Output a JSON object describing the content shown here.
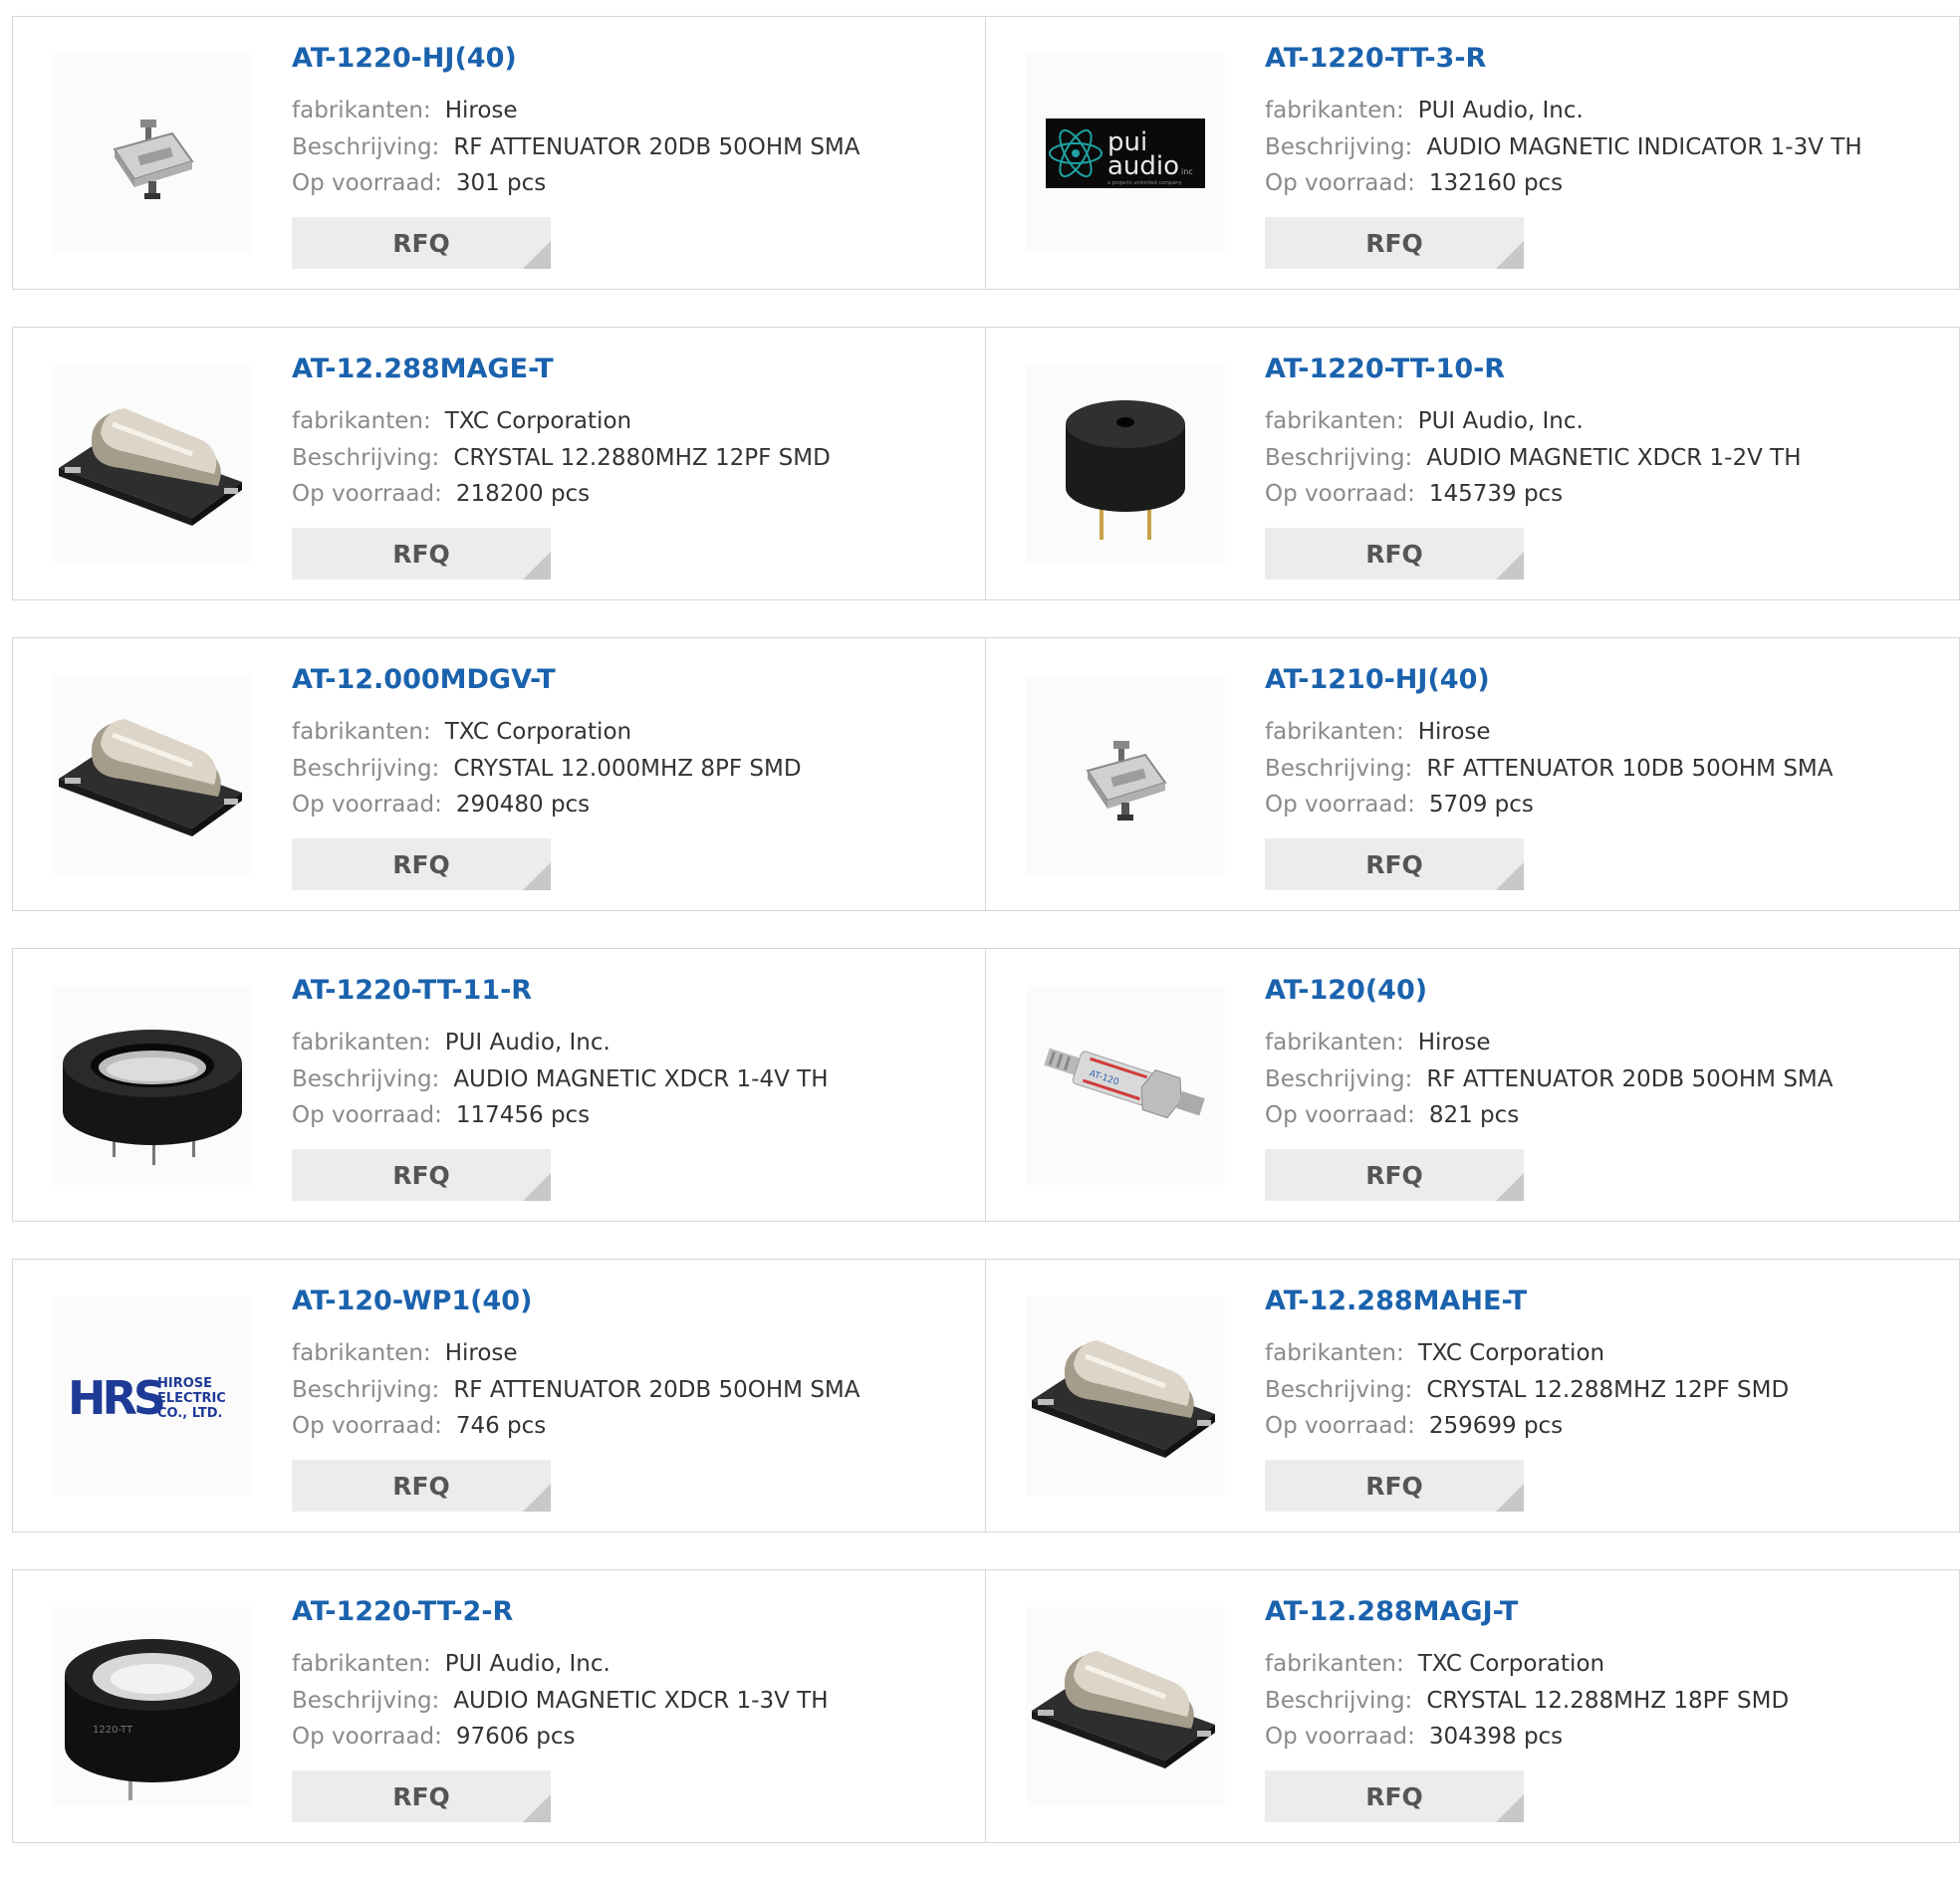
{
  "labels": {
    "manufacturer": "fabrikanten:",
    "description": "Beschrijving:",
    "stock": "Op voorraad:",
    "rfq": "RFQ"
  },
  "colors": {
    "title": "#1a62ad",
    "label": "#8a8a8a",
    "value": "#333333",
    "button_bg": "#ececec",
    "border": "#d7d7d7"
  },
  "logos": {
    "pui": {
      "line1": "pui",
      "line2": "audio",
      "suffix": "inc",
      "tagline": "a projects unlimited company"
    },
    "hrs": {
      "mark": "HRS",
      "line1": "HIROSE",
      "line2": "ELECTRIC",
      "line3": "CO., LTD."
    }
  },
  "products": [
    {
      "part": "AT-1220-HJ(40)",
      "manufacturer": "Hirose",
      "description": "RF ATTENUATOR 20DB 50OHM SMA",
      "stock": "301 pcs",
      "image": "attenuator-small-icon"
    },
    {
      "part": "AT-1220-TT-3-R",
      "manufacturer": "PUI Audio, Inc.",
      "description": "AUDIO MAGNETIC INDICATOR 1-3V TH",
      "stock": "132160 pcs",
      "image": "pui-audio-logo"
    },
    {
      "part": "AT-12.288MAGE-T",
      "manufacturer": "TXC Corporation",
      "description": "CRYSTAL 12.2880MHZ 12PF SMD",
      "stock": "218200 pcs",
      "image": "crystal-smd-icon"
    },
    {
      "part": "AT-1220-TT-10-R",
      "manufacturer": "PUI Audio, Inc.",
      "description": "AUDIO MAGNETIC XDCR 1-2V TH",
      "stock": "145739 pcs",
      "image": "buzzer-icon"
    },
    {
      "part": "AT-12.000MDGV-T",
      "manufacturer": "TXC Corporation",
      "description": "CRYSTAL 12.000MHZ 8PF SMD",
      "stock": "290480 pcs",
      "image": "crystal-smd-icon"
    },
    {
      "part": "AT-1210-HJ(40)",
      "manufacturer": "Hirose",
      "description": "RF ATTENUATOR 10DB 50OHM SMA",
      "stock": "5709 pcs",
      "image": "attenuator-small-icon"
    },
    {
      "part": "AT-1220-TT-11-R",
      "manufacturer": "PUI Audio, Inc.",
      "description": "AUDIO MAGNETIC XDCR 1-4V TH",
      "stock": "117456 pcs",
      "image": "transducer-ring-icon"
    },
    {
      "part": "AT-120(40)",
      "manufacturer": "Hirose",
      "description": "RF ATTENUATOR 20DB 50OHM SMA",
      "stock": "821 pcs",
      "image": "sma-attenuator-icon"
    },
    {
      "part": "AT-120-WP1(40)",
      "manufacturer": "Hirose",
      "description": "RF ATTENUATOR 20DB 50OHM SMA",
      "stock": "746 pcs",
      "image": "hirose-logo"
    },
    {
      "part": "AT-12.288MAHE-T",
      "manufacturer": "TXC Corporation",
      "description": "CRYSTAL 12.288MHZ 12PF SMD",
      "stock": "259699 pcs",
      "image": "crystal-smd-icon"
    },
    {
      "part": "AT-1220-TT-2-R",
      "manufacturer": "PUI Audio, Inc.",
      "description": "AUDIO MAGNETIC XDCR 1-3V TH",
      "stock": "97606 pcs",
      "image": "transducer-white-icon"
    },
    {
      "part": "AT-12.288MAGJ-T",
      "manufacturer": "TXC Corporation",
      "description": "CRYSTAL 12.288MHZ 18PF SMD",
      "stock": "304398 pcs",
      "image": "crystal-smd-icon"
    }
  ]
}
